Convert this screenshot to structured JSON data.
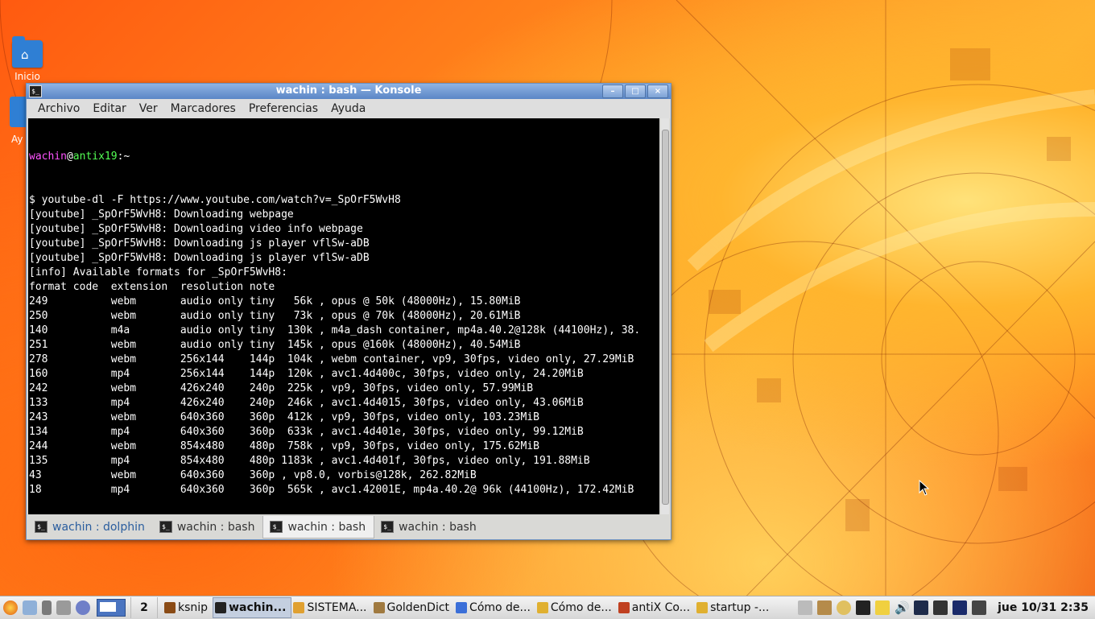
{
  "desktop": {
    "icons": [
      {
        "label": "Inicio"
      },
      {
        "label": "Ay"
      }
    ]
  },
  "window": {
    "title": "wachin : bash — Konsole",
    "buttons": {
      "minimize": "–",
      "maximize": "□",
      "close": "×"
    },
    "menu": [
      "Archivo",
      "Editar",
      "Ver",
      "Marcadores",
      "Preferencias",
      "Ayuda"
    ],
    "prompt": {
      "user": "wachin",
      "at": "@",
      "host": "antix19",
      "path": ":~"
    },
    "terminal_lines": [
      "$ youtube-dl -F https://www.youtube.com/watch?v=_SpOrF5WvH8",
      "[youtube] _SpOrF5WvH8: Downloading webpage",
      "[youtube] _SpOrF5WvH8: Downloading video info webpage",
      "[youtube] _SpOrF5WvH8: Downloading js player vflSw-aDB",
      "[youtube] _SpOrF5WvH8: Downloading js player vflSw-aDB",
      "[info] Available formats for _SpOrF5WvH8:",
      "format code  extension  resolution note",
      "249          webm       audio only tiny   56k , opus @ 50k (48000Hz), 15.80MiB",
      "250          webm       audio only tiny   73k , opus @ 70k (48000Hz), 20.61MiB",
      "140          m4a        audio only tiny  130k , m4a_dash container, mp4a.40.2@128k (44100Hz), 38.",
      "251          webm       audio only tiny  145k , opus @160k (48000Hz), 40.54MiB",
      "278          webm       256x144    144p  104k , webm container, vp9, 30fps, video only, 27.29MiB",
      "160          mp4        256x144    144p  120k , avc1.4d400c, 30fps, video only, 24.20MiB",
      "242          webm       426x240    240p  225k , vp9, 30fps, video only, 57.99MiB",
      "133          mp4        426x240    240p  246k , avc1.4d4015, 30fps, video only, 43.06MiB",
      "243          webm       640x360    360p  412k , vp9, 30fps, video only, 103.23MiB",
      "134          mp4        640x360    360p  633k , avc1.4d401e, 30fps, video only, 99.12MiB",
      "244          webm       854x480    480p  758k , vp9, 30fps, video only, 175.62MiB",
      "135          mp4        854x480    480p 1183k , avc1.4d401f, 30fps, video only, 191.88MiB",
      "43           webm       640x360    360p , vp8.0, vorbis@128k, 262.82MiB",
      "18           mp4        640x360    360p  565k , avc1.42001E, mp4a.40.2@ 96k (44100Hz), 172.42MiB"
    ],
    "cursor_prompt": "$ ",
    "tabs": [
      {
        "label": "wachin : dolphin"
      },
      {
        "label": "wachin : bash"
      },
      {
        "label": "wachin : bash"
      },
      {
        "label": "wachin : bash"
      }
    ]
  },
  "taskbar": {
    "desktop_number": "2",
    "tasks": [
      {
        "label": "ksnip",
        "color": "#8a4b16"
      },
      {
        "label": "wachin...",
        "color": "#222222"
      },
      {
        "label": "SISTEMA...",
        "color": "#e0a030"
      },
      {
        "label": "GoldenDict",
        "color": "#a07a40"
      },
      {
        "label": "Cómo de...",
        "color": "#3b6fd8"
      },
      {
        "label": "Cómo de...",
        "color": "#e0b030"
      },
      {
        "label": "antiX Co...",
        "color": "#c04020"
      },
      {
        "label": "startup -...",
        "color": "#e0b030"
      }
    ],
    "clock": "jue 10/31  2:35"
  },
  "colors": {
    "title_bar": "#5a86c6",
    "prompt_user": "#ff54ff",
    "prompt_host": "#54ff54"
  }
}
